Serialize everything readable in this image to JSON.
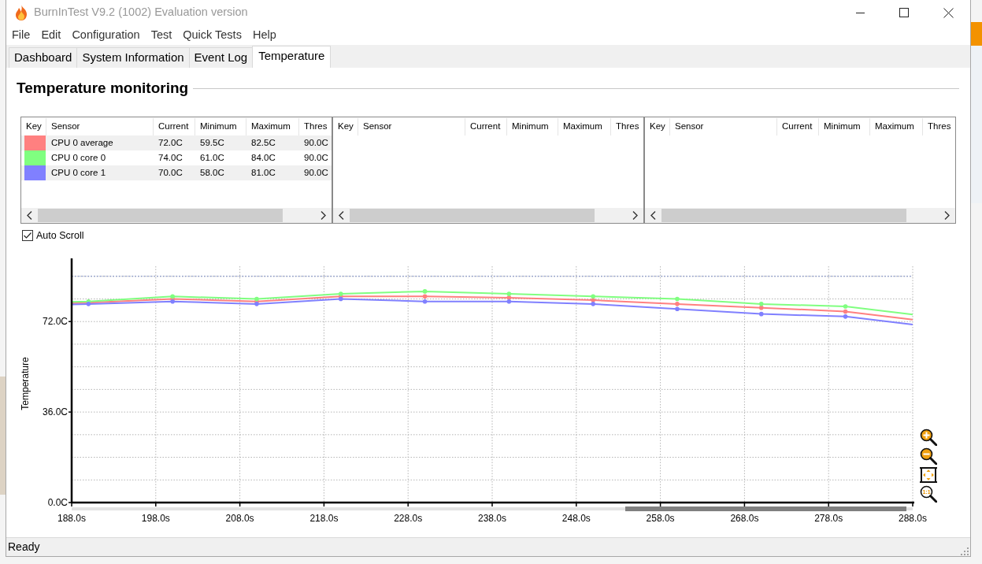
{
  "window": {
    "title": "BurnInTest V9.2 (1002) Evaluation version"
  },
  "menu": [
    "File",
    "Edit",
    "Configuration",
    "Test",
    "Quick Tests",
    "Help"
  ],
  "tabs": [
    {
      "label": "Dashboard",
      "selected": false
    },
    {
      "label": "System Information",
      "selected": false
    },
    {
      "label": "Event Log",
      "selected": false
    },
    {
      "label": "Temperature",
      "selected": true
    }
  ],
  "section": {
    "title": "Temperature monitoring"
  },
  "sensor_tables": [
    {
      "columns": [
        "Key",
        "Sensor",
        "Current",
        "Minimum",
        "Maximum",
        "Thres"
      ],
      "rows": [
        {
          "color": "#ff8080",
          "cells": [
            "",
            "CPU 0 average",
            "72.0C",
            "59.5C",
            "82.5C",
            "90.0C"
          ]
        },
        {
          "color": "#80ff80",
          "cells": [
            "",
            "CPU 0 core 0",
            "74.0C",
            "61.0C",
            "84.0C",
            "90.0C"
          ]
        },
        {
          "color": "#8080ff",
          "cells": [
            "",
            "CPU 0 core 1",
            "70.0C",
            "58.0C",
            "81.0C",
            "90.0C"
          ]
        }
      ]
    },
    {
      "columns": [
        "Key",
        "Sensor",
        "Current",
        "Minimum",
        "Maximum",
        "Thres"
      ]
    },
    {
      "columns": [
        "Key",
        "Sensor",
        "Current",
        "Minimum",
        "Maximum",
        "Thres"
      ]
    }
  ],
  "auto_scroll": {
    "label": "Auto Scroll",
    "checked": true
  },
  "chart": {
    "chart_data": {
      "type": "line",
      "ylabel": "Temperature",
      "x": [
        188,
        190,
        200,
        210,
        220,
        230,
        240,
        250,
        260,
        270,
        280,
        288
      ],
      "series": [
        {
          "color": "#ff8080",
          "values": [
            79.3,
            79.5,
            81,
            80,
            82,
            82,
            81.5,
            80.5,
            79,
            77.5,
            76,
            72.8
          ]
        },
        {
          "color": "#80ff80",
          "values": [
            79.8,
            80,
            82,
            81,
            83,
            84,
            83,
            82,
            81,
            79,
            78,
            74.8
          ]
        },
        {
          "color": "#8080ff",
          "values": [
            78.8,
            79,
            80,
            79,
            81,
            80,
            80,
            79,
            77,
            75,
            74,
            70.8
          ]
        }
      ],
      "xlim": [
        188,
        288
      ],
      "ylim": [
        0,
        94
      ],
      "xticks": [
        {
          "value": 188,
          "label": "188.0s"
        },
        {
          "value": 198,
          "label": "198.0s"
        },
        {
          "value": 208,
          "label": "208.0s"
        },
        {
          "value": 218,
          "label": "218.0s"
        },
        {
          "value": 228,
          "label": "228.0s"
        },
        {
          "value": 238,
          "label": "238.0s"
        },
        {
          "value": 248,
          "label": "248.0s"
        },
        {
          "value": 258,
          "label": "258.0s"
        },
        {
          "value": 268,
          "label": "268.0s"
        },
        {
          "value": 278,
          "label": "278.0s"
        },
        {
          "value": 288,
          "label": "288.0s"
        }
      ],
      "yticks": [
        {
          "value": 0,
          "label": "0.0C"
        },
        {
          "value": 36,
          "label": "36.0C"
        },
        {
          "value": 72,
          "label": "72.0C"
        }
      ],
      "grid": true,
      "ref_lines": [
        {
          "axis": "y",
          "value": 90,
          "color": "#8393c8"
        }
      ]
    }
  },
  "zoom_tools": [
    {
      "kind": "zoom_in"
    },
    {
      "kind": "zoom_out"
    },
    {
      "kind": "fit"
    },
    {
      "kind": "actual_size",
      "label": "1:1"
    }
  ],
  "status_bar": {
    "text": "Ready"
  }
}
